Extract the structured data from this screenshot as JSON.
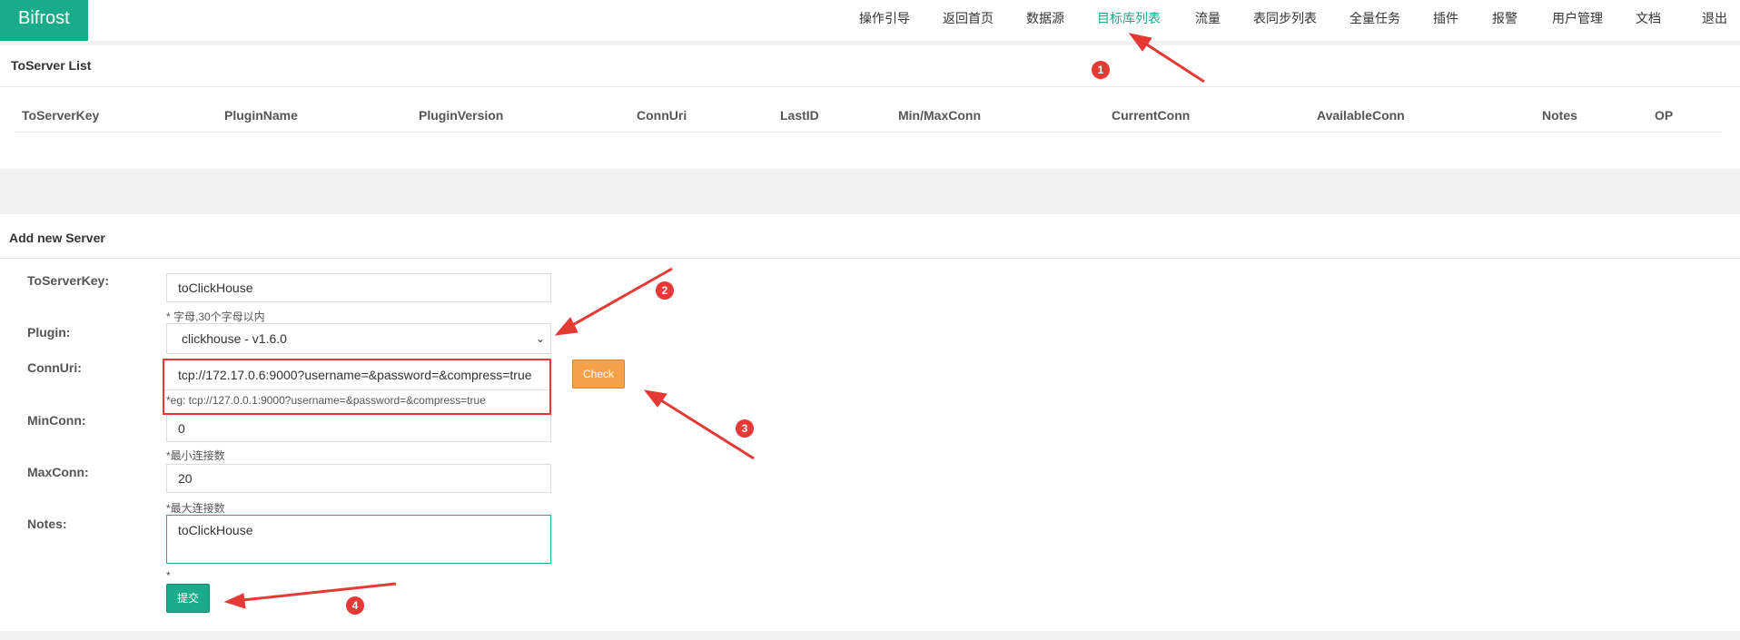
{
  "app": {
    "brand": "Bifrost"
  },
  "nav": {
    "items": [
      {
        "label": "操作引导"
      },
      {
        "label": "返回首页"
      },
      {
        "label": "数据源"
      },
      {
        "label": "目标库列表",
        "active": true
      },
      {
        "label": "流量"
      },
      {
        "label": "表同步列表"
      },
      {
        "label": "全量任务"
      },
      {
        "label": "插件"
      },
      {
        "label": "报警"
      },
      {
        "label": "用户管理"
      },
      {
        "label": "文档"
      },
      {
        "label": "退出"
      }
    ]
  },
  "list_panel": {
    "title": "ToServer List",
    "columns": [
      "ToServerKey",
      "PluginName",
      "PluginVersion",
      "ConnUri",
      "LastID",
      "Min/MaxConn",
      "CurrentConn",
      "AvailableConn",
      "Notes",
      "OP"
    ],
    "rows": []
  },
  "form": {
    "title": "Add new Server",
    "to_server_key": {
      "label": "ToServerKey:",
      "value": "toClickHouse",
      "hint": "* 字母,30个字母以内"
    },
    "plugin": {
      "label": "Plugin:",
      "selected": "clickhouse - v1.6.0"
    },
    "conn_uri": {
      "label": "ConnUri:",
      "value": "tcp://172.17.0.6:9000?username=&password=&compress=true",
      "hint": "*eg: tcp://127.0.0.1:9000?username=&password=&compress=true",
      "check_label": "Check"
    },
    "min_conn": {
      "label": "MinConn:",
      "value": "0",
      "hint": "*最小连接数"
    },
    "max_conn": {
      "label": "MaxConn:",
      "value": "20",
      "hint": "*最大连接数"
    },
    "notes": {
      "label": "Notes:",
      "value": "toClickHouse",
      "hint": "*"
    },
    "submit_label": "提交"
  },
  "annotations": {
    "badges": [
      "1",
      "2",
      "3",
      "4"
    ],
    "color": "#e53935"
  },
  "colors": {
    "accent": "#1aab8a",
    "check_button": "#f5a14a"
  }
}
